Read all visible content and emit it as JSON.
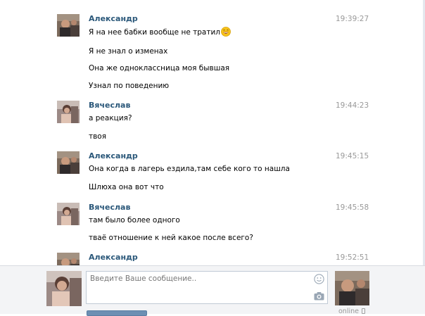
{
  "messages": [
    {
      "author": "Александр",
      "time": "19:39:27",
      "avatar_icon": "alexander-photo",
      "lines": [
        "Я на нее бабки вообще не тратил",
        "Я не знал о изменах",
        "Она же одноклассница моя бывшая",
        "Узнал по поведению"
      ],
      "emoji_icon": "laughing-smiley-icon"
    },
    {
      "author": "Вячеслав",
      "time": "19:44:23",
      "avatar_icon": "vyacheslav-photo",
      "lines": [
        "а реакция?",
        "твоя"
      ]
    },
    {
      "author": "Александр",
      "time": "19:45:15",
      "avatar_icon": "alexander-photo",
      "lines": [
        "Она когда в лагерь ездила,там себе кого то нашла",
        "Шлюха она вот что"
      ]
    },
    {
      "author": "Вячеслав",
      "time": "19:45:58",
      "avatar_icon": "vyacheslav-photo",
      "lines": [
        "там было более одного",
        "тваё отношение к ней какое после всего?"
      ]
    },
    {
      "author": "Александр",
      "time": "19:52:51",
      "avatar_icon": "alexander-photo",
      "lines": []
    }
  ],
  "compose": {
    "placeholder": "Введите Ваше сообщение..",
    "value": "",
    "smile_icon": "smile-icon",
    "attach_icon": "camera-icon",
    "peer_status": "online",
    "status_icon": "mobile-phone-icon"
  },
  "colors": {
    "author": "#2b587a",
    "time": "#999999",
    "compose_bg": "#f3f4f6",
    "send_button": "#6d8fb3"
  }
}
